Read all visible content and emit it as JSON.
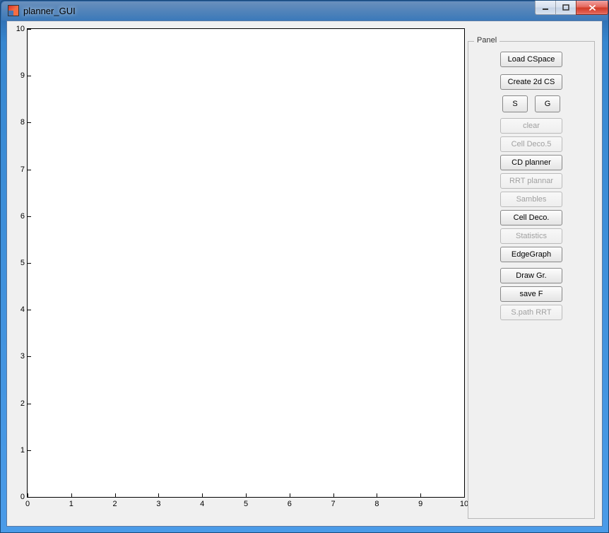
{
  "window": {
    "title": "planner_GUI",
    "controls": {
      "min": "▁",
      "max": "▢",
      "close": "✕"
    }
  },
  "panel": {
    "legend": "Panel",
    "load_cspace": "Load CSpace",
    "create_2d": "Create 2d CS",
    "s_btn": "S",
    "g_btn": "G",
    "clear": "clear",
    "cell_deco5": "Cell Deco.5",
    "cd_planner": "CD planner",
    "rrt_plannar": "RRT plannar",
    "sambles": "Sambles",
    "cell_deco": "Cell Deco.",
    "statistics": "Statistics",
    "edgegraph": "EdgeGraph",
    "draw_gr": "Draw Gr.",
    "save_f": "save F",
    "spath_rrt": "S.path RRT"
  },
  "chart_data": {
    "type": "scatter",
    "series": [],
    "title": "",
    "xlabel": "",
    "ylabel": "",
    "xlim": [
      0,
      10
    ],
    "ylim": [
      0,
      10
    ],
    "xticks": [
      0,
      1,
      2,
      3,
      4,
      5,
      6,
      7,
      8,
      9,
      10
    ],
    "yticks": [
      0,
      1,
      2,
      3,
      4,
      5,
      6,
      7,
      8,
      9,
      10
    ]
  }
}
